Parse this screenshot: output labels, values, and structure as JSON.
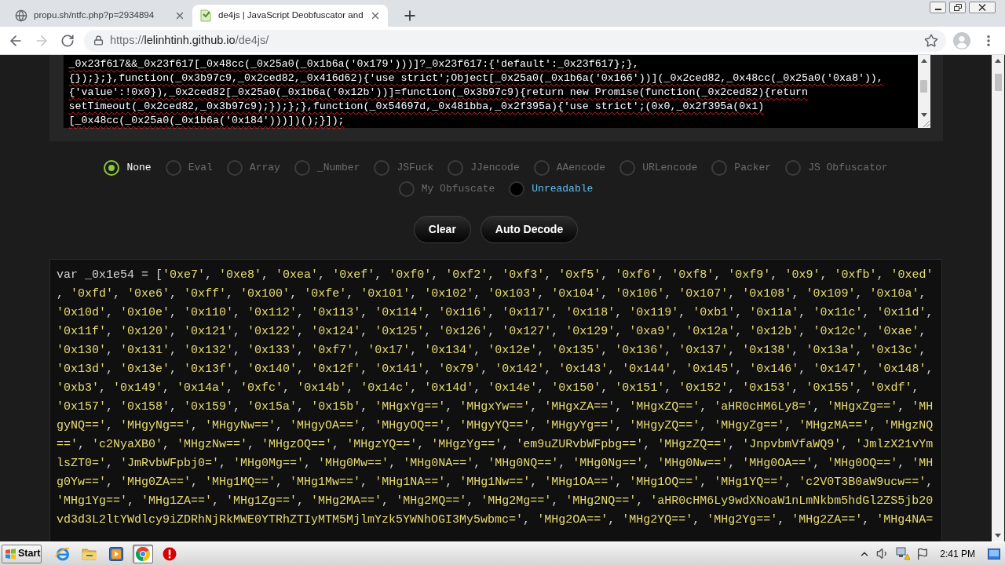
{
  "browser": {
    "tabs": [
      {
        "title": "propu.sh/ntfc.php?p=2934894",
        "selected": false
      },
      {
        "title": "de4js | JavaScript Deobfuscator and",
        "selected": true
      }
    ],
    "address": {
      "scheme": "https://",
      "host": "lelinhtinh.github.io",
      "path": "/de4js/"
    }
  },
  "input": {
    "lines": [
      "_0x23f617&&_0x23f617[_0x48cc(_0x25a0(_0x1b6a('0x179')))]?_0x23f617:{'default':_0x23f617};},",
      "{});};},function(_0x3b97c9,_0x2ced82,_0x416d62){'use strict';Object[_0x25a0(_0x1b6a('0x166'))](_0x2ced82,_0x48cc(_0x25a0('0xa8')),",
      "{'value':!0x0}),_0x2ced82[_0x25a0(_0x1b6a('0x12b'))]=function(_0x3b97c9){return new Promise(function(_0x2ced82){return",
      "setTimeout(_0x2ced82,_0x3b97c9);});};},function(_0x54697d,_0x481bba,_0x2f395a){'use strict';(0x0,_0x2f395a(0x1)",
      "[_0x48cc(_0x25a0(_0x1b6a('0x184')))])();}]);"
    ]
  },
  "methods": [
    {
      "label": "None",
      "selected": true,
      "highlighted": false
    },
    {
      "label": "Eval",
      "selected": false,
      "highlighted": false
    },
    {
      "label": "Array",
      "selected": false,
      "highlighted": false
    },
    {
      "label": "_Number",
      "selected": false,
      "highlighted": false
    },
    {
      "label": "JSFuck",
      "selected": false,
      "highlighted": false
    },
    {
      "label": "JJencode",
      "selected": false,
      "highlighted": false
    },
    {
      "label": "AAencode",
      "selected": false,
      "highlighted": false
    },
    {
      "label": "URLencode",
      "selected": false,
      "highlighted": false
    },
    {
      "label": "Packer",
      "selected": false,
      "highlighted": false
    },
    {
      "label": "JS Obfuscator",
      "selected": false,
      "highlighted": false
    },
    {
      "label": "My Obfuscate",
      "selected": false,
      "highlighted": false
    },
    {
      "label": "Unreadable",
      "selected": false,
      "highlighted": true
    }
  ],
  "buttons": [
    "Clear",
    "Auto Decode"
  ],
  "output": {
    "lines": [
      "var _0x1e54 = ['0xe7', '0xe8', '0xea', '0xef', '0xf0', '0xf2', '0xf3', '0xf5', '0xf6', '0xf8', '0xf9', '0x9', '0xfb', '0xed'",
      ", '0xfd', '0xe6', '0xff', '0x100', '0xfe', '0x101', '0x102', '0x103', '0x104', '0x106', '0x107', '0x108', '0x109', '0x10a',",
      "'0x10d', '0x10e', '0x110', '0x112', '0x113', '0x114', '0x116', '0x117', '0x118', '0x119', '0xb1', '0x11a', '0x11c', '0x11d',",
      "'0x11f', '0x120', '0x121', '0x122', '0x124', '0x125', '0x126', '0x127', '0x129', '0xa9', '0x12a', '0x12b', '0x12c', '0xae',",
      "'0x130', '0x131', '0x132', '0x133', '0xf7', '0x17', '0x134', '0x12e', '0x135', '0x136', '0x137', '0x138', '0x13a', '0x13c',",
      "'0x13d', '0x13e', '0x13f', '0x140', '0x12f', '0x141', '0x79', '0x142', '0x143', '0x144', '0x145', '0x146', '0x147', '0x148',",
      "'0xb3', '0x149', '0x14a', '0xfc', '0x14b', '0x14c', '0x14d', '0x14e', '0x150', '0x151', '0x152', '0x153', '0x155', '0xdf',",
      "'0x157', '0x158', '0x159', '0x15a', '0x15b', 'MHgxYg==', 'MHgxYw==', 'MHgxZA==', 'MHgxZQ==', 'aHR0cHM6Ly8=', 'MHgxZg==', 'MH",
      "gyNQ==', 'MHgyNg==', 'MHgyNw==', 'MHgyOA==', 'MHgyOQ==', 'MHgyYQ==', 'MHgyYg==', 'MHgyZQ==', 'MHgyZg==', 'MHgzMA==', 'MHgzNQ",
      "==', 'c2NyaXB0', 'MHgzNw==', 'MHgzOQ==', 'MHgzYQ==', 'MHgzYg==', 'em9uZURvbWFpbg==', 'MHgzZQ==', 'JnpvbmVfaWQ9', 'JmlzX21vYm",
      "lsZT0=', 'JmRvbWFpbj0=', 'MHg0Mg==', 'MHg0Mw==', 'MHg0NA==', 'MHg0NQ==', 'MHg0Ng==', 'MHg0Nw==', 'MHg0OA==', 'MHg0OQ==', 'MH",
      "g0Yw==', 'MHg0ZA==', 'MHg1MQ==', 'MHg1Mw==', 'MHg1NA==', 'MHg1Nw==', 'MHg1OA==', 'MHg1OQ==', 'MHg1YQ==', 'c2V0T3B0aW9ucw==',",
      "'MHg1Yg==', 'MHg1ZA==', 'MHg1Zg==', 'MHg2MA==', 'MHg2MQ==', 'MHg2Mg==', 'MHg2NQ==', 'aHR0cHM6Ly9wdXNoaW1nLmNkbm5hdGl2ZS5jb20",
      "vd3d3L2ltYWdlcy9iZDRhNjRkMWE0YTRhZTIyMTM5MjlmYzk5YWNhOGI3My5wbmc=', 'MHg2OA==', 'MHg2YQ==', 'MHg2Yg==', 'MHg2ZA==', 'MHg4NA="
    ]
  },
  "taskbar": {
    "start": "Start",
    "apps": [
      {
        "kind": "ie",
        "active": false
      },
      {
        "kind": "folder",
        "active": false
      },
      {
        "kind": "player",
        "active": false
      },
      {
        "kind": "chrome",
        "active": true
      },
      {
        "kind": "stop",
        "active": false
      }
    ],
    "clock": "2:41 PM"
  }
}
